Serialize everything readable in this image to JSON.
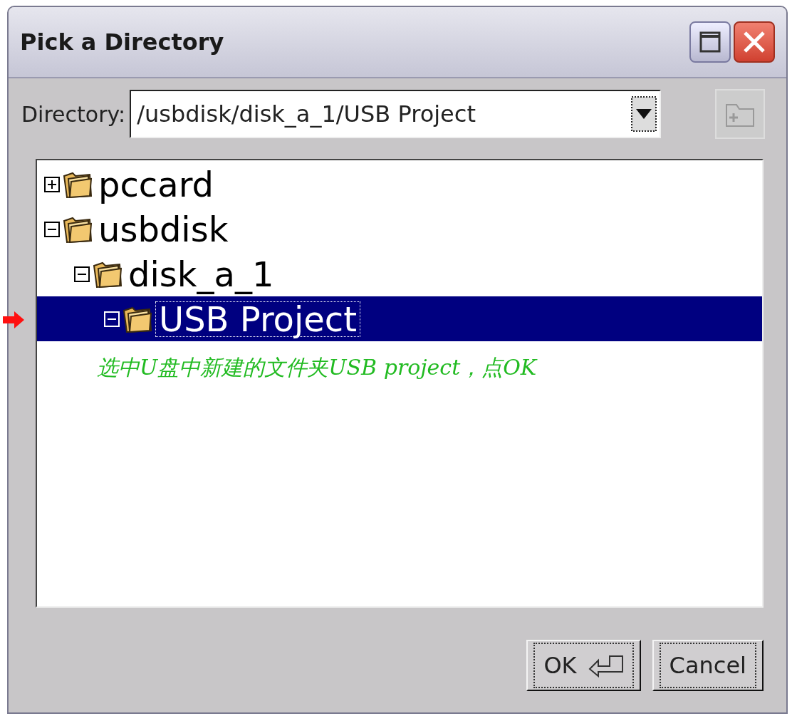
{
  "window": {
    "title": "Pick a Directory"
  },
  "directory": {
    "label": "Directory:",
    "value": "/usbdisk/disk_a_1/USB Project"
  },
  "tree": [
    {
      "label": "pccard",
      "expanded": false,
      "selected": false
    },
    {
      "label": "usbdisk",
      "expanded": true,
      "selected": false,
      "children": [
        {
          "label": "disk_a_1",
          "expanded": true,
          "selected": false,
          "children": [
            {
              "label": "USB Project",
              "expanded": true,
              "selected": true
            }
          ]
        }
      ]
    }
  ],
  "annotation": "选中U盘中新建的文件夹USB project，点OK",
  "buttons": [
    {
      "label": "OK",
      "kind": "default"
    },
    {
      "label": "Cancel",
      "kind": "normal"
    }
  ]
}
